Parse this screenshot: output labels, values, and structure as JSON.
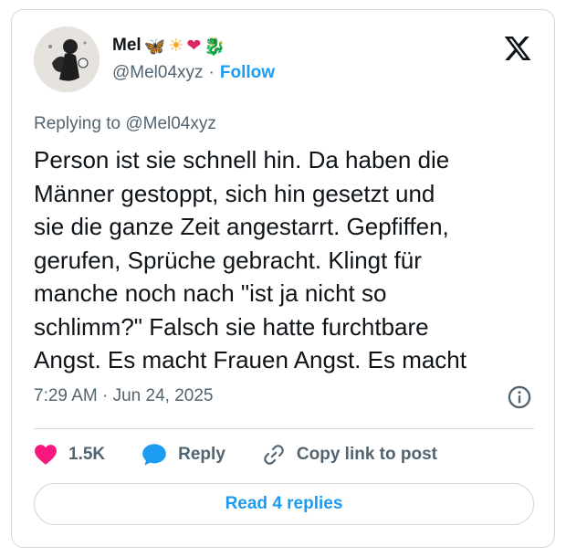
{
  "author": {
    "name": "Mel",
    "emojis": [
      {
        "glyph": "🦋",
        "name": "butterfly-icon",
        "color": "#1d9bf0"
      },
      {
        "glyph": "☀",
        "name": "sun-icon",
        "color": "#f5a623"
      },
      {
        "glyph": "❤",
        "name": "heart-emoji-icon",
        "color": "#e0245e"
      },
      {
        "glyph": "🐉",
        "name": "dragon-icon",
        "color": "#2e9e44"
      }
    ],
    "handle": "@Mel04xyz",
    "separator": "·",
    "follow_label": "Follow"
  },
  "replying_to": "Replying to @Mel04xyz",
  "tweet_lines": [
    "Person ist sie schnell hin. Da haben die",
    "Männer gestoppt, sich hin gesetzt und",
    "sie die ganze Zeit angestarrt. Gepfiffen,",
    "gerufen, Sprüche gebracht. Klingt für",
    "manche noch nach \"ist ja nicht so",
    "schlimm?\" Falsch sie hatte furchtbare",
    "Angst. Es macht Frauen Angst. Es macht"
  ],
  "timestamp": "7:29 AM · Jun 24, 2025",
  "actions": {
    "likes_count": "1.5K",
    "reply_label": "Reply",
    "copy_link_label": "Copy link to post"
  },
  "read_replies_label": "Read 4 replies",
  "colors": {
    "accent": "#1d9bf0",
    "like": "#f91880",
    "muted": "#536471",
    "border": "#cfd9de"
  }
}
